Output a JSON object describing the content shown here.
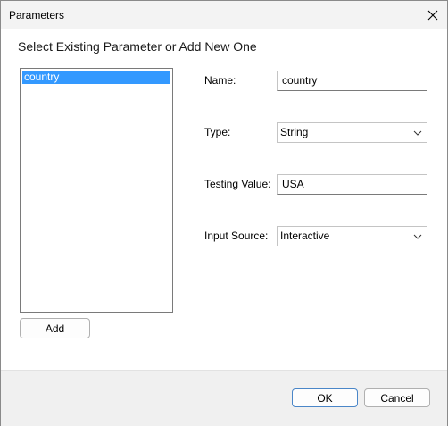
{
  "window": {
    "title": "Parameters"
  },
  "heading": "Select Existing Parameter or Add New One",
  "parameters": {
    "items": [
      "country"
    ],
    "selected": "country"
  },
  "buttons": {
    "add": "Add",
    "ok": "OK",
    "cancel": "Cancel"
  },
  "form": {
    "name_label": "Name:",
    "name_value": "country",
    "type_label": "Type:",
    "type_value": "String",
    "testing_label": "Testing Value:",
    "testing_value": "USA",
    "source_label": "Input Source:",
    "source_value": "Interactive"
  },
  "colors": {
    "selection": "#3399ff",
    "footer": "#f0f0f0",
    "titlebar": "#f3f3f3"
  }
}
